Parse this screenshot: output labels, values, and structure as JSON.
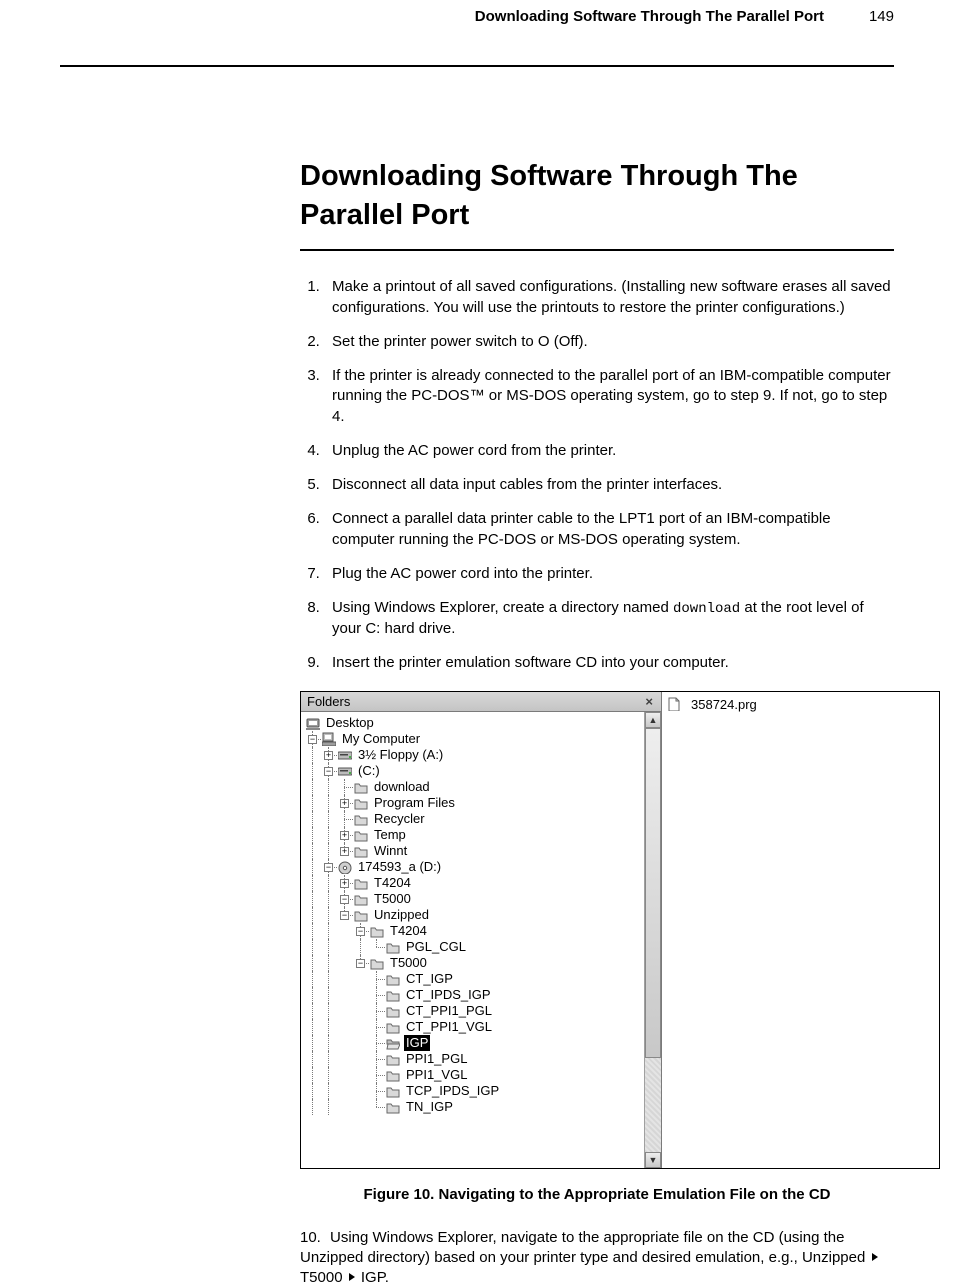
{
  "page_number": "149",
  "header_right": "Downloading Software Through The Parallel Port",
  "section_title": "Downloading Software Through The Parallel Port",
  "steps": [
    "Make a printout of all saved configurations. (Installing new software erases all saved configurations. You will use the printouts to restore the printer configurations.)",
    "Set the printer power switch to O (Off).",
    "If the printer is already connected to the parallel port of an IBM-compatible computer running the PC-DOS™ or MS-DOS operating system, go to step 9. If not, go to step 4.",
    "Unplug the AC power cord from the printer.",
    "Disconnect all data input cables from the printer interfaces.",
    "Connect a parallel data printer cable to the LPT1 port of an IBM-compatible computer running the PC-DOS or MS-DOS operating system.",
    "Plug the AC power cord into the printer.",
    "Using Windows Explorer, create a directory named <span class=\"prg\">download</span> at the root level of your C: hard drive.",
    "Insert the printer emulation software CD into your computer."
  ],
  "step10": "Using Windows Explorer, navigate to the appropriate file on the CD (using the Unzipped directory) based on your printer type and desired emulation, e.g., Unzipped ",
  "step10_b": " T5000 ",
  "step10_c": " IGP.",
  "folders_panel_title": "Folders",
  "tree": {
    "desktop": "Desktop",
    "my_computer": "My Computer",
    "floppy": "3½ Floppy (A:)",
    "c_drive": "(C:)",
    "download": "download",
    "program_files": "Program Files",
    "recycler": "Recycler",
    "temp": "Temp",
    "winnt": "Winnt",
    "cd": "174593_a (D:)",
    "t4204": "T4204",
    "t5000": "T5000",
    "unzipped": "Unzipped",
    "u_t4204": "T4204",
    "pgl_cgl": "PGL_CGL",
    "u_t5000": "T5000",
    "ct_igp": "CT_IGP",
    "ct_ipds_igp": "CT_IPDS_IGP",
    "ct_ppi1_pgl": "CT_PPI1_PGL",
    "ct_ppi1_vgl": "CT_PPI1_VGL",
    "igp": "IGP",
    "ppi1_pgl": "PPI1_PGL",
    "ppi1_vgl": "PPI1_VGL",
    "tcp_ipds_igp": "TCP_IPDS_IGP",
    "tn_igp": "TN_IGP"
  },
  "file_in_pane": "358724.prg",
  "figure_caption": "Figure 10. Navigating to the Appropriate Emulation File on the CD"
}
